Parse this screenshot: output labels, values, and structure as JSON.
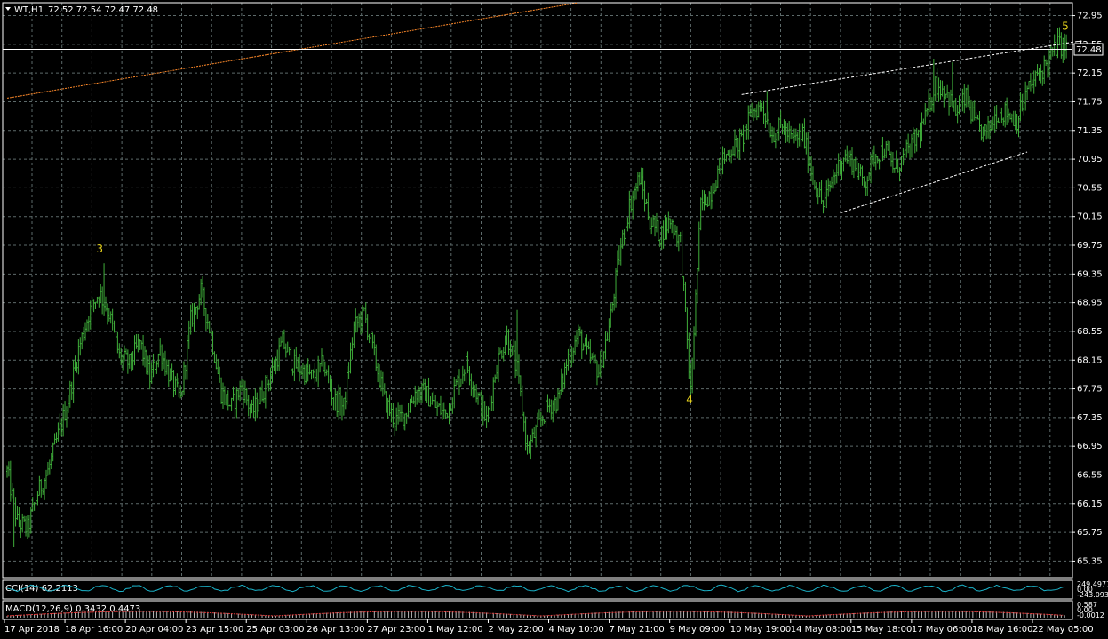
{
  "header": {
    "symbol_timeframe": "WT,H1",
    "ohlc": "72.52 72.54 72.47 72.48"
  },
  "price_tag": "72.48",
  "colors": {
    "background": "#000000",
    "grid": "#5d6a6a",
    "bar": "#3fae3a",
    "trendline": "#ffffff",
    "ma_line": "#ff8a2a",
    "wave_label": "#e6d21c",
    "axis_text": "#ffffff"
  },
  "chart_data": {
    "type": "ohlc-bar",
    "instrument": "WT",
    "timeframe": "H1",
    "ylim": [
      65.12,
      73.13
    ],
    "yticks": [
      "72.95",
      "72.55",
      "72.15",
      "71.75",
      "71.35",
      "70.95",
      "70.55",
      "70.15",
      "69.75",
      "69.35",
      "68.95",
      "68.55",
      "68.15",
      "67.75",
      "67.35",
      "66.95",
      "66.55",
      "66.15",
      "65.75",
      "65.35"
    ],
    "xticks": [
      "17 Apr 2018",
      "18 Apr 16:00",
      "20 Apr 04:00",
      "23 Apr 15:00",
      "25 Apr 03:00",
      "26 Apr 13:00",
      "27 Apr 23:00",
      "1 May 12:00",
      "2 May 22:00",
      "4 May 10:00",
      "7 May 21:00",
      "9 May 09:00",
      "10 May 19:00",
      "14 May 08:00",
      "15 May 18:00",
      "17 May 06:00",
      "18 May 16:00",
      "22 May 05:00"
    ],
    "close_path": [
      [
        0,
        66.6
      ],
      [
        6,
        65.9
      ],
      [
        12,
        65.8
      ],
      [
        18,
        66.3
      ],
      [
        24,
        66.6
      ],
      [
        30,
        67.1
      ],
      [
        36,
        67.6
      ],
      [
        42,
        68.3
      ],
      [
        48,
        68.8
      ],
      [
        54,
        69.1
      ],
      [
        60,
        68.8
      ],
      [
        66,
        68.2
      ],
      [
        72,
        68.1
      ],
      [
        78,
        68.4
      ],
      [
        84,
        67.9
      ],
      [
        90,
        68.3
      ],
      [
        96,
        67.9
      ],
      [
        102,
        67.6
      ],
      [
        108,
        68.7
      ],
      [
        114,
        69.1
      ],
      [
        120,
        68.5
      ],
      [
        126,
        67.7
      ],
      [
        132,
        67.5
      ],
      [
        138,
        67.8
      ],
      [
        144,
        67.4
      ],
      [
        150,
        67.7
      ],
      [
        156,
        68.0
      ],
      [
        162,
        68.4
      ],
      [
        168,
        68.1
      ],
      [
        174,
        68.0
      ],
      [
        180,
        67.9
      ],
      [
        186,
        68.1
      ],
      [
        192,
        67.6
      ],
      [
        198,
        67.5
      ],
      [
        204,
        68.6
      ],
      [
        210,
        68.8
      ],
      [
        216,
        68.2
      ],
      [
        222,
        67.6
      ],
      [
        228,
        67.3
      ],
      [
        234,
        67.4
      ],
      [
        240,
        67.7
      ],
      [
        246,
        67.7
      ],
      [
        252,
        67.5
      ],
      [
        258,
        67.4
      ],
      [
        264,
        67.8
      ],
      [
        270,
        68.1
      ],
      [
        276,
        67.7
      ],
      [
        282,
        67.3
      ],
      [
        288,
        68.1
      ],
      [
        294,
        68.5
      ],
      [
        300,
        68.0
      ],
      [
        306,
        66.9
      ],
      [
        312,
        67.2
      ],
      [
        318,
        67.5
      ],
      [
        324,
        67.6
      ],
      [
        330,
        68.2
      ],
      [
        336,
        68.5
      ],
      [
        342,
        68.2
      ],
      [
        348,
        68.0
      ],
      [
        354,
        68.6
      ],
      [
        360,
        69.6
      ],
      [
        366,
        70.3
      ],
      [
        372,
        70.7
      ],
      [
        378,
        70.1
      ],
      [
        384,
        69.9
      ],
      [
        390,
        70.1
      ],
      [
        396,
        69.8
      ],
      [
        402,
        67.7
      ],
      [
        408,
        70.3
      ],
      [
        414,
        70.5
      ],
      [
        420,
        70.9
      ],
      [
        426,
        71.1
      ],
      [
        432,
        71.2
      ],
      [
        438,
        71.6
      ],
      [
        444,
        71.7
      ],
      [
        450,
        71.3
      ],
      [
        456,
        71.4
      ],
      [
        462,
        71.2
      ],
      [
        468,
        71.3
      ],
      [
        474,
        70.7
      ],
      [
        480,
        70.3
      ],
      [
        486,
        70.7
      ],
      [
        492,
        71.0
      ],
      [
        498,
        70.9
      ],
      [
        504,
        70.6
      ],
      [
        510,
        71.0
      ],
      [
        516,
        71.1
      ],
      [
        522,
        70.8
      ],
      [
        528,
        71.0
      ],
      [
        534,
        71.2
      ],
      [
        540,
        71.5
      ],
      [
        546,
        72.0
      ],
      [
        552,
        71.9
      ],
      [
        558,
        71.6
      ],
      [
        564,
        71.8
      ],
      [
        570,
        71.4
      ],
      [
        576,
        71.3
      ],
      [
        582,
        71.6
      ],
      [
        588,
        71.6
      ],
      [
        594,
        71.5
      ],
      [
        600,
        71.9
      ],
      [
        606,
        72.1
      ],
      [
        612,
        72.3
      ],
      [
        618,
        72.55
      ],
      [
        624,
        72.5
      ]
    ],
    "n_bars": 624,
    "wave_labels": [
      {
        "text": "3",
        "bar": 54,
        "price": 69.65
      },
      {
        "text": "4",
        "bar": 401,
        "price": 67.55
      },
      {
        "text": "5",
        "bar": 622,
        "price": 72.75
      }
    ],
    "trendlines": [
      {
        "bar1": 432,
        "p1": 71.85,
        "bar2": 632,
        "p2": 72.6
      },
      {
        "bar1": 490,
        "p1": 70.2,
        "bar2": 600,
        "p2": 71.05
      }
    ],
    "ma_line": {
      "bar1": 0,
      "p1": 71.8,
      "bar2": 336,
      "p2": 73.2
    },
    "subwindows": [
      {
        "label": "CCI(14) 62.2113",
        "right_values": [
          "249.4977",
          "0.00",
          "-243.093"
        ]
      },
      {
        "label": "MACD(12,26,9) 0.3432 0.4473",
        "right_values": [
          "0.587",
          "0.00",
          "-0.0012"
        ]
      }
    ]
  }
}
